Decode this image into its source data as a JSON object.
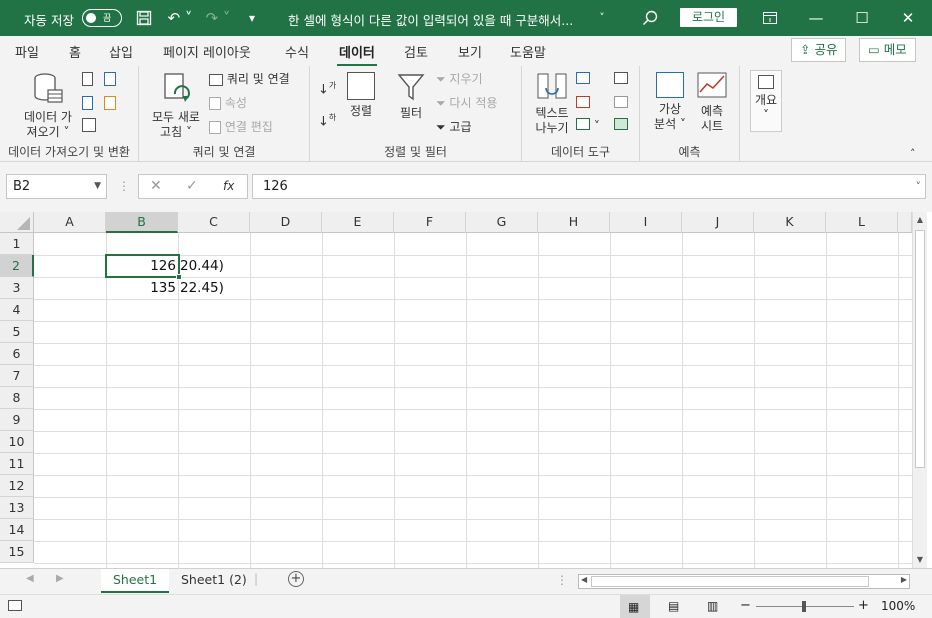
{
  "title_bar": {
    "autosave_label": "자동 저장",
    "autosave_state": "끔",
    "document_title": "한 셀에 형식이 다른 값이 입력되어 있을 때 구분해서...",
    "login_label": "로그인"
  },
  "ribbon_tabs": [
    "파일",
    "홈",
    "삽입",
    "페이지 레이아웃",
    "수식",
    "데이터",
    "검토",
    "보기",
    "도움말"
  ],
  "active_tab": "데이터",
  "share_label": "공유",
  "memo_label": "메모",
  "ribbon": {
    "get_data": {
      "line1": "데이터 가",
      "line2": "져오기 ˅",
      "group": "데이터 가져오기 및 변환"
    },
    "queries": {
      "refresh_line1": "모두 새로",
      "refresh_line2": "고침 ˅",
      "queries_connections": "쿼리 및 연결",
      "properties": "속성",
      "edit_links": "연결 편집",
      "group": "쿼리 및 연결"
    },
    "sort_filter": {
      "sort": "정렬",
      "filter": "필터",
      "clear": "지우기",
      "reapply": "다시 적용",
      "advanced": "고급",
      "group": "정렬 및 필터"
    },
    "data_tools": {
      "text_to_columns_line1": "텍스트",
      "text_to_columns_line2": "나누기",
      "group": "데이터 도구"
    },
    "forecast": {
      "whatif_line1": "가상",
      "whatif_line2": "분석 ˅",
      "forecast_line1": "예측",
      "forecast_line2": "시트",
      "group": "예측"
    },
    "outline": {
      "label": "개요"
    }
  },
  "formula_bar": {
    "name_box": "B2",
    "formula_value": "126",
    "fx_label": "fx"
  },
  "columns": [
    "A",
    "B",
    "C",
    "D",
    "E",
    "F",
    "G",
    "H",
    "I",
    "J",
    "K",
    "L"
  ],
  "rows": [
    "1",
    "2",
    "3",
    "4",
    "5",
    "6",
    "7",
    "8",
    "9",
    "10",
    "11",
    "12",
    "13",
    "14",
    "15"
  ],
  "cells": {
    "B2": "126",
    "C2": "20.44)",
    "B3": "135",
    "C3": "22.45)"
  },
  "sheets": [
    "Sheet1",
    "Sheet1 (2)"
  ],
  "active_sheet": "Sheet1",
  "status_bar": {
    "zoom": "100%"
  },
  "colors": {
    "accent": "#217346"
  }
}
